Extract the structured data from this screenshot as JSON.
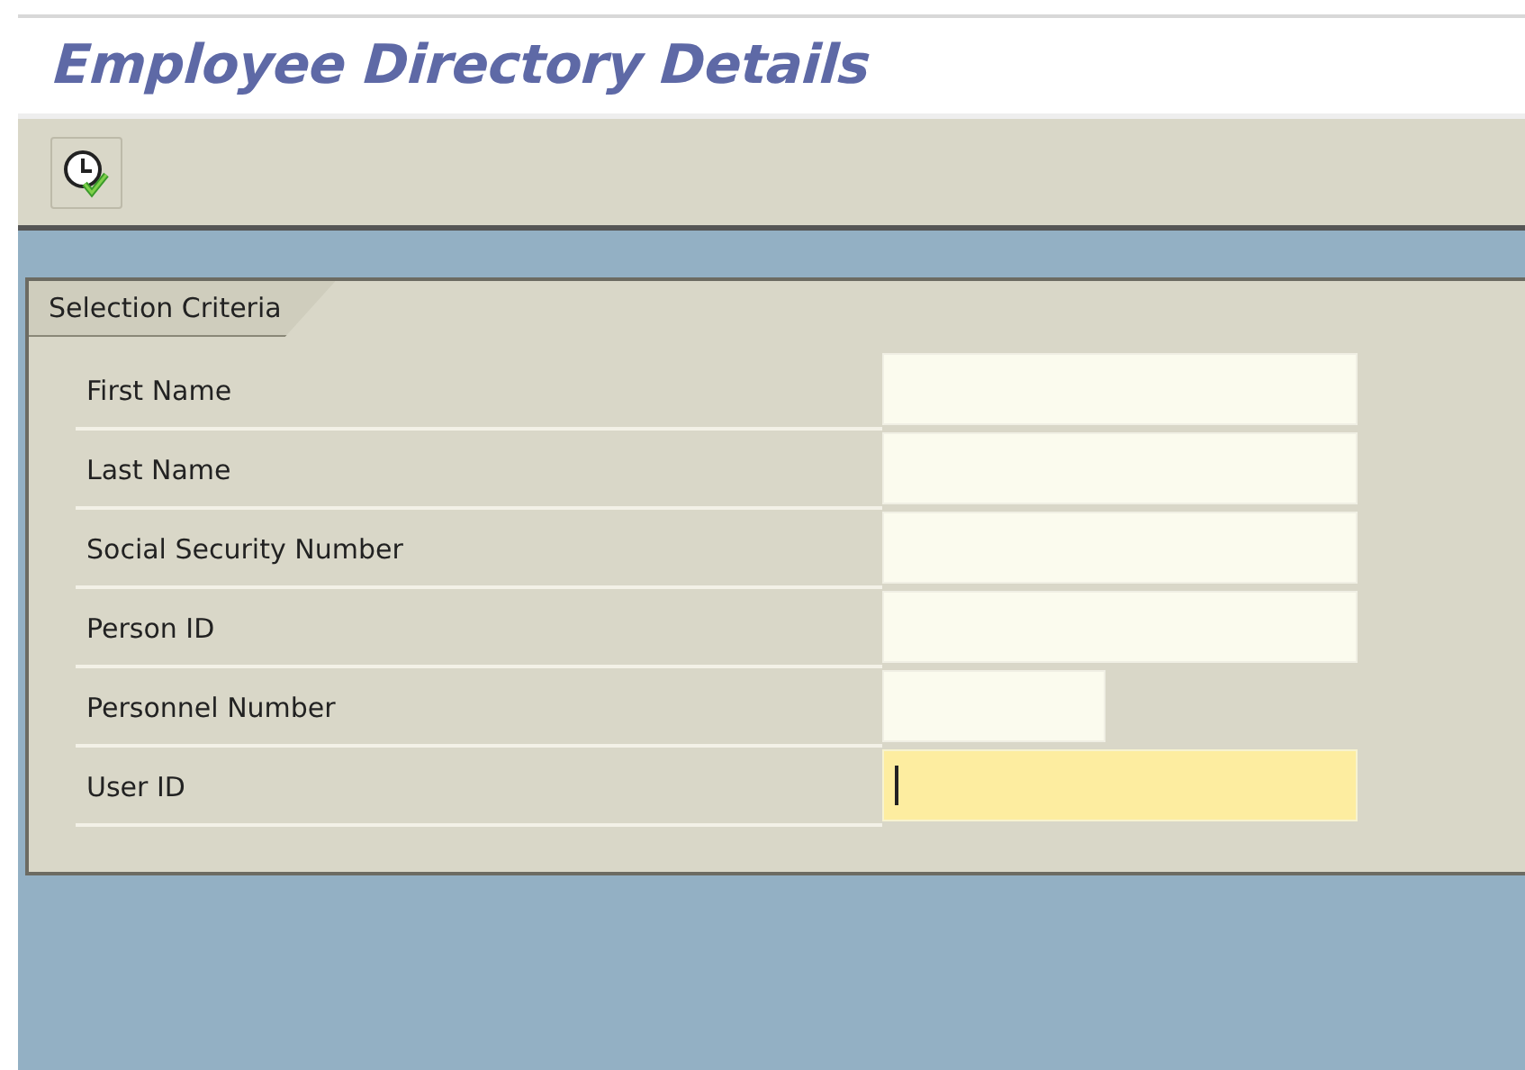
{
  "window": {
    "title": "Employee Directory Details"
  },
  "toolbar": {
    "buttons": [
      {
        "kind": "execute"
      }
    ]
  },
  "selection_group": {
    "title": "Selection Criteria",
    "fields": [
      {
        "label": "First Name",
        "kind": "wide",
        "focused": false
      },
      {
        "label": "Last Name",
        "kind": "wide",
        "focused": false
      },
      {
        "label": "Social Security Number",
        "kind": "wide",
        "focused": false
      },
      {
        "label": "Person ID",
        "kind": "wide",
        "focused": false
      },
      {
        "label": "Personnel Number",
        "kind": "narrow",
        "focused": false
      },
      {
        "label": "User ID",
        "kind": "wide",
        "focused": true
      }
    ]
  }
}
